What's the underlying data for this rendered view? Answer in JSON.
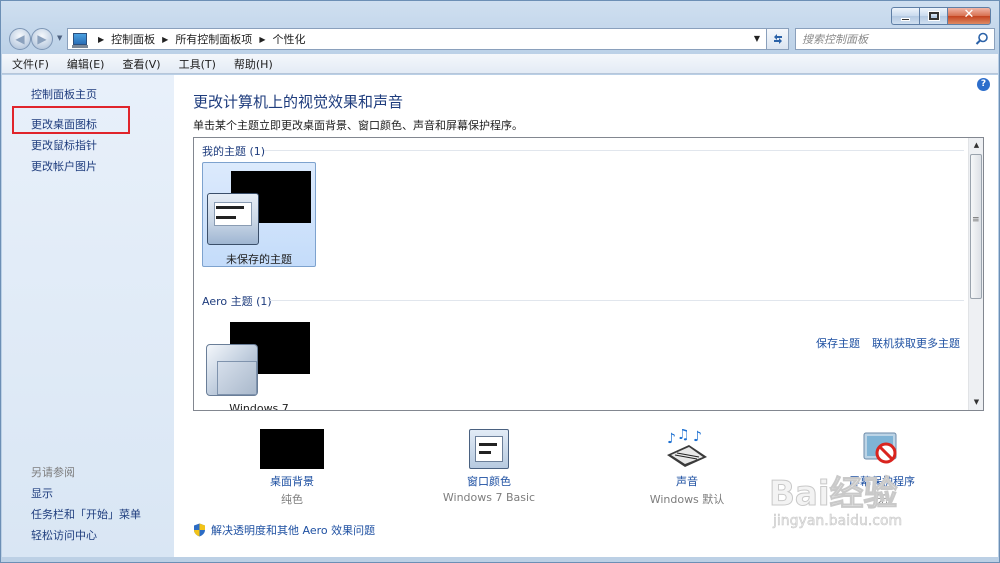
{
  "address": {
    "crumbs": [
      "控制面板",
      "所有控制面板项",
      "个性化"
    ]
  },
  "search": {
    "placeholder": "搜索控制面板"
  },
  "menu": [
    "文件(F)",
    "编辑(E)",
    "查看(V)",
    "工具(T)",
    "帮助(H)"
  ],
  "sidebar": {
    "home": "控制面板主页",
    "links": [
      "更改桌面图标",
      "更改鼠标指针",
      "更改帐户图片"
    ],
    "see_also_title": "另请参阅",
    "see_also": [
      "显示",
      "任务栏和「开始」菜单",
      "轻松访问中心"
    ]
  },
  "main": {
    "title": "更改计算机上的视觉效果和声音",
    "description": "单击某个主题立即更改桌面背景、窗口颜色、声音和屏幕保护程序。",
    "my_themes_heading": "我的主题 (1)",
    "unsaved_theme": "未保存的主题",
    "save_theme": "保存主题",
    "get_more_themes": "联机获取更多主题",
    "aero_heading": "Aero 主题 (1)",
    "aero_theme": "Windows 7"
  },
  "settings": [
    {
      "label": "桌面背景",
      "value": "纯色"
    },
    {
      "label": "窗口颜色",
      "value": "Windows 7 Basic"
    },
    {
      "label": "声音",
      "value": "Windows 默认"
    },
    {
      "label": "屏幕保护程序",
      "value": "无"
    }
  ],
  "footer_link": "解决透明度和其他 Aero 效果问题",
  "watermark": {
    "brand": "Bai经验",
    "url": "jingyan.baidu.com"
  },
  "colors": {
    "highlight": "#e0242b",
    "link": "#1e50a2",
    "title": "#1e3c7d"
  }
}
